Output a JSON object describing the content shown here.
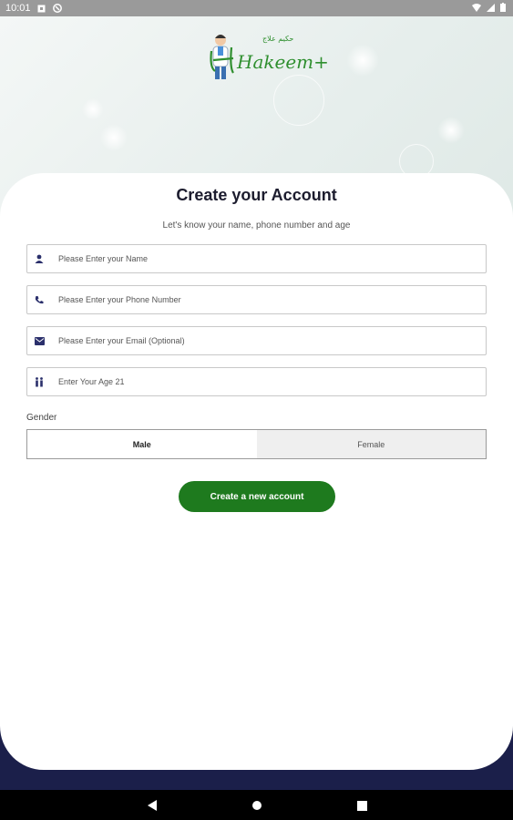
{
  "status_bar": {
    "time": "10:01"
  },
  "header": {
    "logo_arabic": "حكيم علاج",
    "logo_text": "Hakeem+"
  },
  "form": {
    "title": "Create your Account",
    "subtitle": "Let's know your name, phone number and age",
    "name_placeholder": "Please Enter your Name",
    "phone_placeholder": "Please Enter your Phone Number",
    "email_placeholder": "Please Enter your Email (Optional)",
    "age_placeholder": "Enter Your Age 21",
    "gender_label": "Gender",
    "gender_options": [
      "Male",
      "Female"
    ],
    "gender_selected": "Male",
    "submit_label": "Create a new account"
  },
  "colors": {
    "primary_green": "#1e7a1e",
    "navy": "#1b1f4a",
    "icon_navy": "#2a2f6b"
  },
  "icons": {
    "name": "person-icon",
    "phone": "phone-icon",
    "email": "mail-icon",
    "age": "people-icon"
  }
}
